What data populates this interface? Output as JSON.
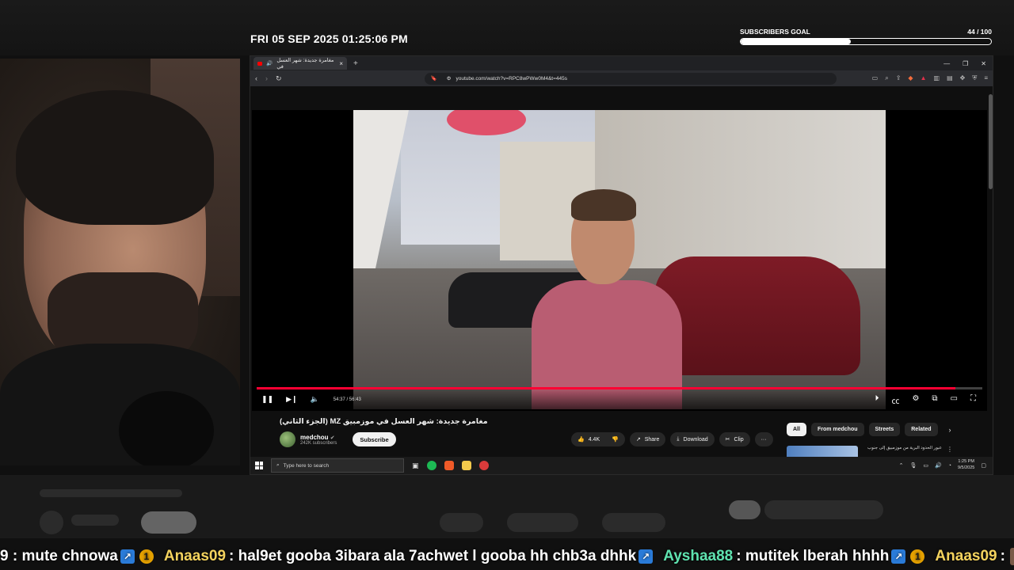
{
  "overlay": {
    "datetime": "FRI 05 SEP 2025 01:25:06 PM",
    "goal_label": "SUBSCRIBERS GOAL",
    "goal_count": "44 / 100",
    "goal_progress": 0.44
  },
  "browser": {
    "tab_title": "مغامرة جديدة: شهر العسل في",
    "url": "youtube.com/watch?v=RPC8wPWw0M4&t=445s"
  },
  "player": {
    "time": "54:37 / 56:43",
    "progress": 0.963
  },
  "video": {
    "title": "مغامرة جديدة: شهر العسل في موزمبيق MZ (الجزء الثاني)",
    "channel": "medchou",
    "verified": "✔",
    "subscribers": "242K subscribers",
    "subscribe_label": "Subscribe",
    "likes": "4.4K",
    "share_label": "Share",
    "download_label": "Download",
    "clip_label": "Clip",
    "more_label": "···"
  },
  "chips": [
    "All",
    "From medchou",
    "Streets",
    "Related"
  ],
  "recommendation": {
    "title": "عبور الحدود البرية من موزمبيق إلى جنوب"
  },
  "taskbar": {
    "search_placeholder": "Type here to search",
    "time": "1:25 PM",
    "date": "9/5/2025"
  },
  "chat": [
    {
      "user": "",
      "text": "9 : mute chnowa"
    },
    {
      "user": "Anaas09",
      "text": ": hal9et gooba 3ibara ala 7achwet l gooba hh chb3a dhhk"
    },
    {
      "user": "Ayshaa88",
      "text": ": mutitek lberah hhhh"
    },
    {
      "user": "Anaas09",
      "text": ":"
    }
  ]
}
